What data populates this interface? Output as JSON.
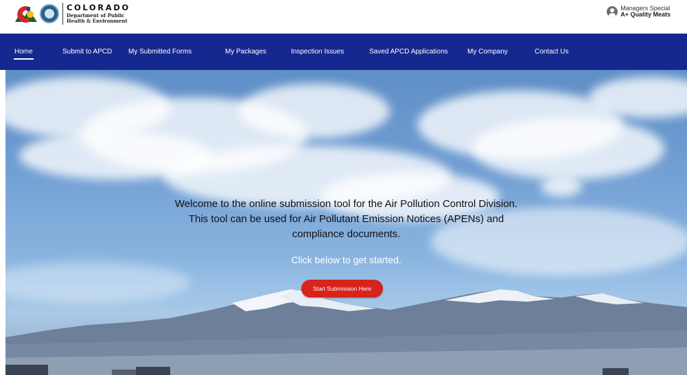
{
  "header": {
    "logo": {
      "state_name": "COLORADO",
      "dept_line1": "Department of Public",
      "dept_line2": "Health & Environment",
      "seal_text": "CDPHE"
    },
    "user": {
      "name": "Managers Special",
      "company": "A+ Quality Meats",
      "icon": "user-avatar-icon"
    }
  },
  "nav": {
    "items": [
      {
        "label": "Home",
        "active": true
      },
      {
        "label": "Submit to APCD"
      },
      {
        "label": "My Submitted Forms"
      },
      {
        "label": "My Packages"
      },
      {
        "label": "Inspection Issues"
      },
      {
        "label": "Saved APCD Applications"
      },
      {
        "label": "My Company"
      },
      {
        "label": "Contact Us"
      }
    ]
  },
  "hero": {
    "welcome_line1": "Welcome to the online submission tool for the Air Pollution Control Division.",
    "welcome_line2": "This tool can be used for Air Pollutant Emission Notices (APENs) and",
    "welcome_line3": "compliance documents.",
    "subtext": "Click below to get started.",
    "cta_label": "Start Submission Here"
  },
  "colors": {
    "nav_bg": "#15288f",
    "cta_bg": "#d7231b",
    "text_white": "#ffffff"
  }
}
